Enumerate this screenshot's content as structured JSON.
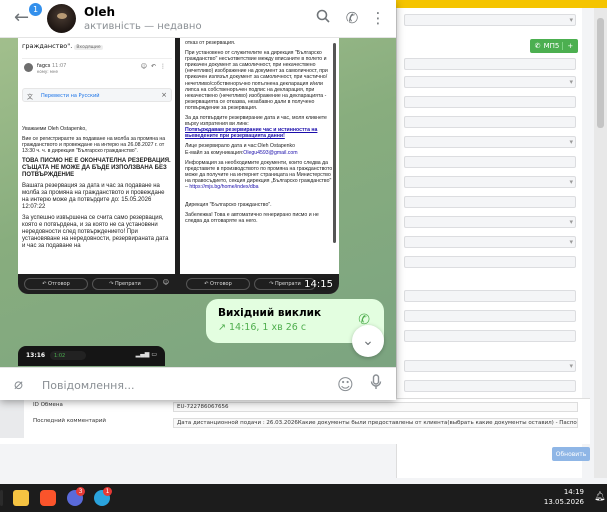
{
  "telegram": {
    "unread_badge": "1",
    "contact_name": "Oleh",
    "contact_status": "активність — недавно",
    "composer_placeholder": "Повідомлення...",
    "call": {
      "title": "Вихідний виклик",
      "details": "14:16, 1 хв 26 с"
    }
  },
  "screenshot": {
    "top_text": "гражданство\".",
    "top_tag": "Входящие",
    "sender_name": "fagcs",
    "sender_time": "11:07",
    "sender_sub": "кому: мне",
    "translate_label": "Перевести на Русский",
    "greeting": "Уважаеми Oleh Ostapenko,",
    "para1": "Вие се регистрирахте за подаване на молба за промяна на гражданството и провеждане на интерю на 26.08.2027 г. от 13:30 ч. ч. в дирекция \"Българско гражданство\".",
    "warning": "ТОВА ПИСМО НЕ Е ОКОНЧАТЕЛНА РЕЗЕРВАЦИЯ. СЪЩАТА НЕ МОЖЕ ДА БЪДЕ ИЗПОЛЗВАНА БЕЗ ПОТВЪРЖДЕНИЕ",
    "para2": "Вашата резервация за дата и час за подаване на молба за промяна на гражданството и провеждане на интерю може да потвърдите до: 15.05.2026 12:07:22",
    "para3": "За успешно извършена се счита само резервация, която е потвърдена, и за която не са установени нередовности след потвърждението! При установяване на нередовности, резервираната дата и час за подаване на",
    "reply_label": "Отговор",
    "forward_label": "Препрати",
    "right_para1": "отказ от резервация.",
    "right_para2": "При установено от служителите на дирекция \"Българско гражданство\" несъответствие между вписаните в полето и прикачен документ за самоличност, при некачествено (нечетливо) изображение на документ за самоличност, при прикачен излязъл документ за самоличност, при частично/нечетливо/собственоръчно попълнена декларация и/или липса на собственоръчен подпис на декларация, при некачествено (нечетливо) изображение на декларацията - резервацията се отказва, незабавно дали в получено потвърждение за резервация.",
    "right_para3": "За да потвърдите резервирание дата и час, моля кликнете върху изпратения ви линк:",
    "right_link": "Потвърждавам резервирание час и истинността на вьеведените при резервацията данни!",
    "right_para4": "Лице резервирало дата и час:Oleh Ostapenko",
    "right_email_label": "E-майл за комуникация:",
    "right_email": "Olegu4593@gmail.com",
    "right_para5": "Информация за необходимите документи, които следва да представите в производството по промяна на гражданството може да получите на интернет страницата на Министерство на правосъдието, секция дирекция „Българско гражданство\" –",
    "right_url": "https://mjs.bg/home/index/dba",
    "right_para6": "Дирекция \"Българско гражданство\".",
    "right_para7": "Забележка! Това е автоматично генерирано писмо и не следва да отговаряте на него.",
    "time": "14:15"
  },
  "screenshot2": {
    "time": "13:16",
    "pill": "1:02"
  },
  "crm": {
    "green_button": "МП5",
    "green_plus": "+",
    "row1_label": "ID Обмена",
    "row1_value": "EU-722786067656",
    "row2_label": "Последний комментарий",
    "row2_value": "Дата дистанционной подачи : 26.03.2026Какие документы были предоставлены от клиента(выбрать какие документы оставил) - Паспорт внутренний все страница",
    "save_button": "Обновить"
  },
  "taskbar": {
    "chat_badge": "3",
    "tg_badge": "1",
    "time": "14:19",
    "date": "13.05.2026"
  }
}
